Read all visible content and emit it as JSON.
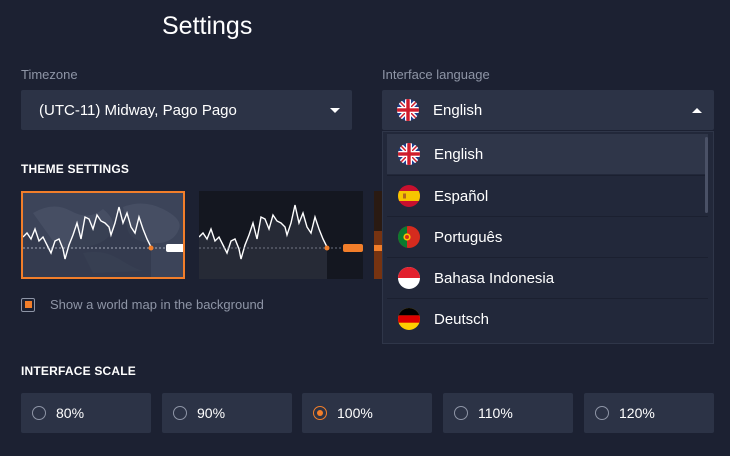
{
  "page": {
    "title": "Settings"
  },
  "timezone": {
    "label": "Timezone",
    "value": "(UTC-11) Midway, Pago Pago"
  },
  "language": {
    "label": "Interface language",
    "value": "English",
    "options": [
      {
        "label": "English",
        "flag": "uk-flag-icon"
      },
      {
        "label": "Español",
        "flag": "spain-flag-icon"
      },
      {
        "label": "Português",
        "flag": "portugal-flag-icon"
      },
      {
        "label": "Bahasa Indonesia",
        "flag": "indonesia-flag-icon"
      },
      {
        "label": "Deutsch",
        "flag": "germany-flag-icon"
      }
    ]
  },
  "theme": {
    "heading": "THEME SETTINGS",
    "map_checkbox_label": "Show a world map in the background",
    "map_checkbox_checked": true,
    "accent_color": "#f27e2a"
  },
  "scale": {
    "heading": "INTERFACE SCALE",
    "options": [
      "80%",
      "90%",
      "100%",
      "110%",
      "120%"
    ],
    "selected": "100%"
  }
}
